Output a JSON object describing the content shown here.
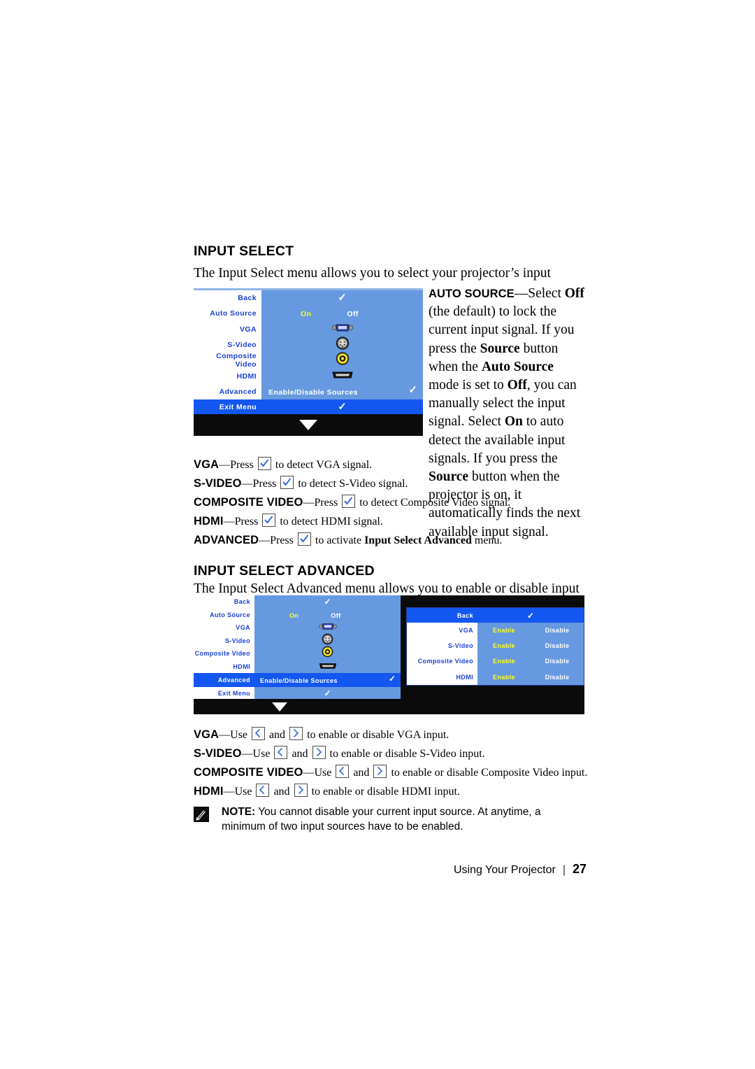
{
  "section1": {
    "heading": "INPUT SELECT",
    "intro": "The Input Select menu allows you to select your projector’s input source."
  },
  "auto_source_paragraph": {
    "term": "AUTO SOURCE",
    "text_1": "—Select ",
    "b1": "Off",
    "text_2": " (the default) to lock the current input signal. If you press the ",
    "b2": "Source",
    "text_3": " button when the ",
    "b3": "Auto Source",
    "text_4": " mode is set to ",
    "b4": "Off",
    "text_5": ", you can manually select the input signal. Select ",
    "b5": "On",
    "text_6": " to auto detect the available input signals. If you press the ",
    "b6": "Source",
    "text_7": " button when the projector is on, it automatically finds the next available input signal."
  },
  "osd1": {
    "rows": [
      {
        "label": "Back",
        "value": "",
        "check": true
      },
      {
        "label": "Auto Source",
        "on": "On",
        "off": "Off"
      },
      {
        "label": "VGA",
        "icon": "vga-connector-icon"
      },
      {
        "label": "S-Video",
        "icon": "svideo-connector-icon"
      },
      {
        "label": "Composite Video",
        "icon": "composite-connector-icon"
      },
      {
        "label": "HDMI",
        "icon": "hdmi-connector-icon"
      },
      {
        "label": "Advanced",
        "value": "Enable/Disable Sources",
        "check": true
      }
    ],
    "exit": {
      "label": "Exit Menu",
      "check": true
    },
    "scroll_icon": "scroll-down-arrow-icon"
  },
  "list1": [
    {
      "term": "VGA",
      "pre": "—Press ",
      "key": "enter-key-icon",
      "post": " to detect VGA signal."
    },
    {
      "term": "S-VIDEO",
      "pre": "—Press ",
      "key": "enter-key-icon",
      "post": " to detect S-Video signal."
    },
    {
      "term": "COMPOSITE VIDEO",
      "pre": "—Press ",
      "key": "enter-key-icon",
      "post": " to detect Composite Video signal."
    },
    {
      "term": "HDMI",
      "pre": "—Press ",
      "key": "enter-key-icon",
      "post": " to detect HDMI signal."
    },
    {
      "term": "ADVANCED",
      "pre": "—Press ",
      "key": "enter-key-icon",
      "post": " to activate ",
      "bold": "Input Select Advanced",
      "tail": " menu."
    }
  ],
  "section2": {
    "heading": "INPUT SELECT ADVANCED",
    "intro": "The Input Select Advanced menu allows you to enable or disable input sources."
  },
  "osd2": {
    "left_rows": [
      {
        "label": "Back",
        "value": "",
        "check": true
      },
      {
        "label": "Auto Source",
        "on": "On",
        "off": "Off"
      },
      {
        "label": "VGA",
        "icon": "vga-connector-icon"
      },
      {
        "label": "S-Video",
        "icon": "svideo-connector-icon"
      },
      {
        "label": "Composite Video",
        "icon": "composite-connector-icon"
      },
      {
        "label": "HDMI",
        "icon": "hdmi-connector-icon"
      },
      {
        "label": "Advanced",
        "value": "Enable/Disable Sources",
        "check": true,
        "highlight": true
      },
      {
        "label": "Exit Menu",
        "value": "",
        "check": true
      }
    ],
    "submenu": {
      "back": {
        "label": "Back",
        "check": true
      },
      "rows": [
        {
          "label": "VGA",
          "enable": "Enable",
          "disable": "Disable"
        },
        {
          "label": "S-Video",
          "enable": "Enable",
          "disable": "Disable"
        },
        {
          "label": "Composite Video",
          "enable": "Enable",
          "disable": "Disable"
        },
        {
          "label": "HDMI",
          "enable": "Enable",
          "disable": "Disable"
        }
      ]
    },
    "scroll_icon": "scroll-down-arrow-icon"
  },
  "list2": [
    {
      "term": "VGA",
      "pre": "—Use ",
      "mid": " and ",
      "post": " to enable or disable VGA input."
    },
    {
      "term": "S-VIDEO",
      "pre": "—Use ",
      "mid": " and ",
      "post": " to enable or disable S-Video input."
    },
    {
      "term": "COMPOSITE VIDEO",
      "pre": "—Use ",
      "mid": " and ",
      "post": " to enable or disable Composite Video input."
    },
    {
      "term": "HDMI",
      "pre": "—Use ",
      "mid": " and ",
      "post": " to enable or disable HDMI input."
    }
  ],
  "note": {
    "icon": "note-pencil-icon",
    "label": "NOTE:",
    "text": "You cannot disable your current input source. At anytime, a minimum of two input sources have to be enabled."
  },
  "footer": {
    "title": "Using Your Projector",
    "separator": "|",
    "page": "27"
  },
  "colors": {
    "osd_panel_blue": "#6699e0",
    "osd_highlight_blue": "#1357f0",
    "osd_label_blue": "#1a3fd4",
    "osd_selected_yellow": "#ffff18",
    "osd_black": "#0b0b0b"
  }
}
